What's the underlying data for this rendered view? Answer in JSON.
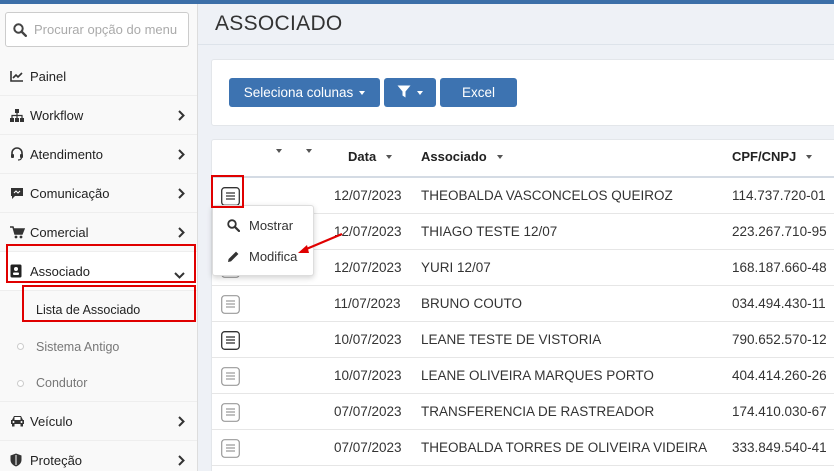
{
  "search": {
    "placeholder": "Procurar opção do menu"
  },
  "sidebar": {
    "items": [
      {
        "label": "Painel",
        "icon": "chart-line-icon"
      },
      {
        "label": "Workflow",
        "icon": "sitemap-icon"
      },
      {
        "label": "Atendimento",
        "icon": "headset-icon"
      },
      {
        "label": "Comunicação",
        "icon": "chat-icon"
      },
      {
        "label": "Comercial",
        "icon": "cart-icon"
      },
      {
        "label": "Associado",
        "icon": "id-badge-icon"
      }
    ],
    "submenu": [
      {
        "label": "Lista de Associado"
      },
      {
        "label": "Sistema Antigo"
      },
      {
        "label": "Condutor"
      }
    ],
    "items_after": [
      {
        "label": "Veículo",
        "icon": "car-icon"
      },
      {
        "label": "Proteção",
        "icon": "shield-icon"
      }
    ]
  },
  "page": {
    "title": "ASSOCIADO"
  },
  "toolbar": {
    "columns_label": "Seleciona colunas",
    "excel_label": "Excel"
  },
  "table": {
    "headers": {
      "data": "Data",
      "associado": "Associado",
      "cpf": "CPF/CNPJ"
    },
    "rows": [
      {
        "date": "12/07/2023",
        "name": "THEOBALDA VASCONCELOS QUEIROZ",
        "cpf": "114.737.720-01"
      },
      {
        "date": "12/07/2023",
        "name": "THIAGO TESTE 12/07",
        "cpf": "223.267.710-95"
      },
      {
        "date": "12/07/2023",
        "name": "YURI 12/07",
        "cpf": "168.187.660-48"
      },
      {
        "date": "11/07/2023",
        "name": "BRUNO COUTO",
        "cpf": "034.494.430-11"
      },
      {
        "date": "10/07/2023",
        "name": "LEANE TESTE DE VISTORIA",
        "cpf": "790.652.570-12"
      },
      {
        "date": "10/07/2023",
        "name": "LEANE OLIVEIRA MARQUES PORTO",
        "cpf": "404.414.260-26"
      },
      {
        "date": "07/07/2023",
        "name": "TRANSFERENCIA DE RASTREADOR",
        "cpf": "174.410.030-67"
      },
      {
        "date": "07/07/2023",
        "name": "THEOBALDA TORRES DE OLIVEIRA VIDEIRA",
        "cpf": "333.849.540-41"
      }
    ]
  },
  "dropdown": {
    "items": [
      {
        "label": "Mostrar"
      },
      {
        "label": "Modifica"
      }
    ]
  },
  "colors": {
    "primary": "#3d73b1",
    "highlight": "#e00000"
  }
}
